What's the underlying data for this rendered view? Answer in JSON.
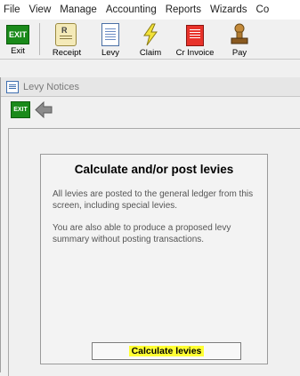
{
  "menu": [
    "File",
    "View",
    "Manage",
    "Accounting",
    "Reports",
    "Wizards",
    "Co"
  ],
  "toolbar": {
    "exit_icon_text": "EXIT",
    "buttons": [
      {
        "label": "Exit",
        "icon": "exit-icon"
      },
      {
        "label": "Receipt",
        "icon": "receipt-icon"
      },
      {
        "label": "Levy",
        "icon": "levy-icon"
      },
      {
        "label": "Claim",
        "icon": "claim-icon"
      },
      {
        "label": "Cr Invoice",
        "icon": "cr-invoice-icon"
      },
      {
        "label": "Pay",
        "icon": "pay-icon"
      }
    ]
  },
  "window": {
    "title": "Levy Notices",
    "sub_exit_text": "EXIT"
  },
  "panel": {
    "heading": "Calculate and/or post levies",
    "paragraph1": "All levies are posted to the general ledger from this screen, including special levies.",
    "paragraph2": "You are also able to produce a proposed levy summary without posting transactions.",
    "button_label": "Calculate levies"
  },
  "colors": {
    "highlight": "#ffff33",
    "exit_green": "#1a8a1a"
  }
}
